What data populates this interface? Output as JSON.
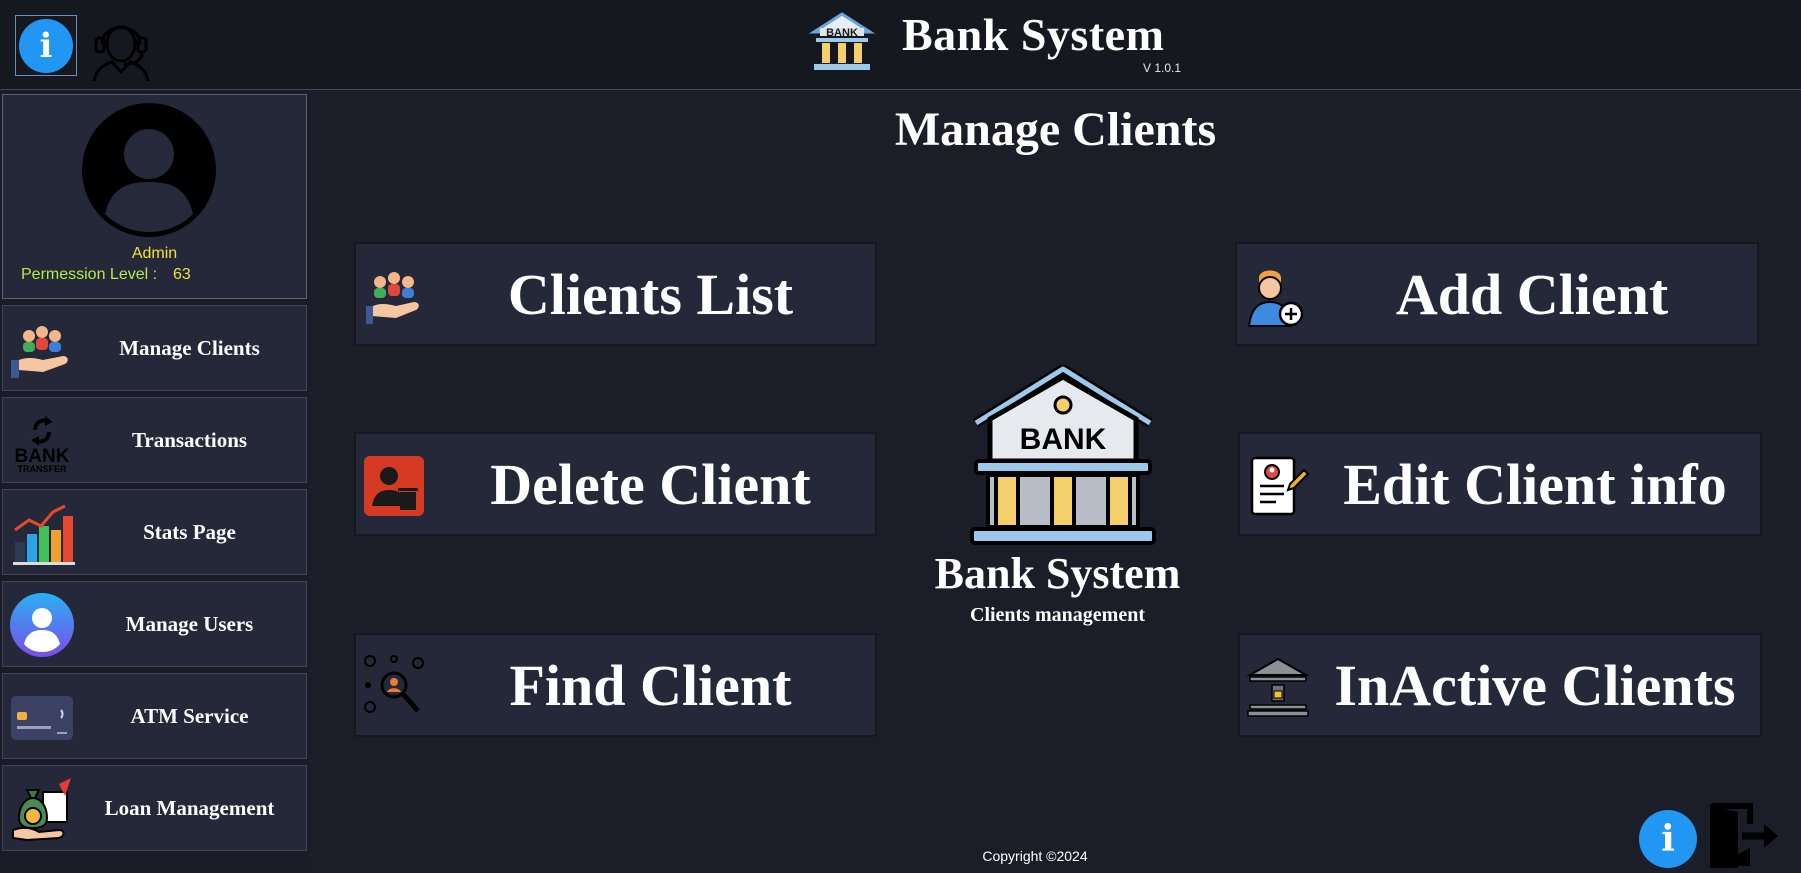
{
  "header": {
    "app_title": "Bank System",
    "version": "V 1.0.1",
    "info_glyph": "i",
    "icons": [
      "info-icon",
      "support-headset-icon",
      "bank-logo-icon"
    ]
  },
  "profile": {
    "username": "Admin",
    "permission_label": "Permession Level :",
    "permission_value": "63"
  },
  "sidebar": {
    "items": [
      {
        "label": "Manage Clients",
        "icon": "manage-clients-icon"
      },
      {
        "label": "Transactions",
        "icon": "bank-transfer-icon",
        "icon_text": [
          "BANK",
          "TRANSFER"
        ]
      },
      {
        "label": "Stats Page",
        "icon": "stats-chart-icon"
      },
      {
        "label": "Manage Users",
        "icon": "manage-users-icon"
      },
      {
        "label": "ATM Service",
        "icon": "atm-card-icon"
      },
      {
        "label": "Loan Management",
        "icon": "loan-money-bag-icon"
      }
    ]
  },
  "main": {
    "page_title": "Manage Clients",
    "actions": {
      "clients_list": "Clients List",
      "add_client": "Add Client",
      "delete_client": "Delete Client",
      "edit_client": "Edit Client info",
      "find_client": "Find Client",
      "inactive_clients": "InActive Clients"
    },
    "center": {
      "logo_text": "BANK",
      "title": "Bank System",
      "subtitle": "Clients management"
    }
  },
  "footer": {
    "copyright": "Copyright ©2024",
    "info_glyph": "i"
  },
  "colors": {
    "background": "#1b1e29",
    "panel": "#242839",
    "header": "#161820",
    "accent_blue": "#2196f3",
    "admin_yellow": "#f0e23a",
    "permission_green": "#b9e84a"
  }
}
